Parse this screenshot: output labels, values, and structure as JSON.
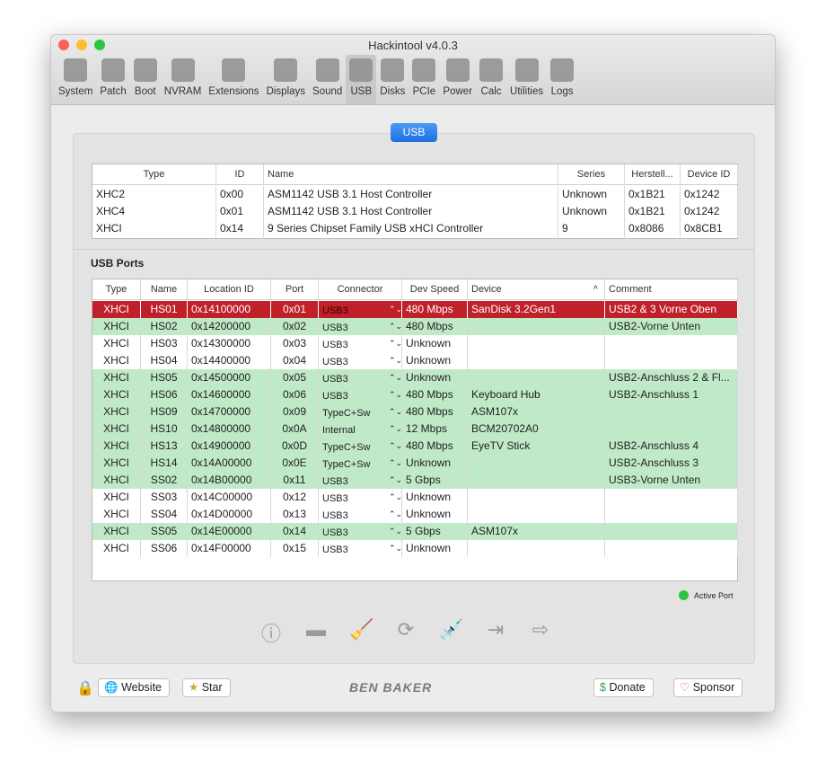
{
  "window": {
    "title": "Hackintool v4.0.3"
  },
  "toolbar": [
    "System",
    "Patch",
    "Boot",
    "NVRAM",
    "Extensions",
    "Displays",
    "Sound",
    "USB",
    "Disks",
    "PCIe",
    "Power",
    "Calc",
    "Utilities",
    "Logs"
  ],
  "active_tab": "USB",
  "section_tab": "USB",
  "controllers": {
    "headers": [
      "Type",
      "ID",
      "Name",
      "Series",
      "Herstell...",
      "Device ID"
    ],
    "rows": [
      [
        "XHC2",
        "0x00",
        "ASM1142 USB 3.1 Host Controller",
        "Unknown",
        "0x1B21",
        "0x1242"
      ],
      [
        "XHC4",
        "0x01",
        "ASM1142 USB 3.1 Host Controller",
        "Unknown",
        "0x1B21",
        "0x1242"
      ],
      [
        "XHCI",
        "0x14",
        "9 Series Chipset Family USB xHCI Controller",
        "9",
        "0x8086",
        "0x8CB1"
      ]
    ]
  },
  "ports_title": "USB Ports",
  "ports": {
    "headers": [
      "Type",
      "Name",
      "Location ID",
      "Port",
      "Connector",
      "Dev Speed",
      "Device",
      "Comment"
    ],
    "rows": [
      {
        "c": [
          "XHCI",
          "HS01",
          "0x14100000",
          "0x01",
          "USB3",
          "480 Mbps",
          "SanDisk 3.2Gen1",
          "USB2 & 3 Vorne Oben"
        ],
        "state": "selected"
      },
      {
        "c": [
          "XHCI",
          "HS02",
          "0x14200000",
          "0x02",
          "USB3",
          "480 Mbps",
          "",
          "USB2-Vorne Unten"
        ],
        "state": "active"
      },
      {
        "c": [
          "XHCI",
          "HS03",
          "0x14300000",
          "0x03",
          "USB3",
          "Unknown",
          "",
          ""
        ],
        "state": ""
      },
      {
        "c": [
          "XHCI",
          "HS04",
          "0x14400000",
          "0x04",
          "USB3",
          "Unknown",
          "",
          ""
        ],
        "state": ""
      },
      {
        "c": [
          "XHCI",
          "HS05",
          "0x14500000",
          "0x05",
          "USB3",
          "Unknown",
          "",
          "USB2-Anschluss 2 & Fl..."
        ],
        "state": "active"
      },
      {
        "c": [
          "XHCI",
          "HS06",
          "0x14600000",
          "0x06",
          "USB3",
          "480 Mbps",
          "Keyboard Hub",
          "USB2-Anschluss 1"
        ],
        "state": "active"
      },
      {
        "c": [
          "XHCI",
          "HS09",
          "0x14700000",
          "0x09",
          "TypeC+Sw",
          "480 Mbps",
          "ASM107x",
          ""
        ],
        "state": "active"
      },
      {
        "c": [
          "XHCI",
          "HS10",
          "0x14800000",
          "0x0A",
          "Internal",
          "12 Mbps",
          "BCM20702A0",
          ""
        ],
        "state": "active"
      },
      {
        "c": [
          "XHCI",
          "HS13",
          "0x14900000",
          "0x0D",
          "TypeC+Sw",
          "480 Mbps",
          "EyeTV Stick",
          "USB2-Anschluss 4"
        ],
        "state": "active"
      },
      {
        "c": [
          "XHCI",
          "HS14",
          "0x14A00000",
          "0x0E",
          "TypeC+Sw",
          "Unknown",
          "",
          "USB2-Anschluss 3"
        ],
        "state": "active"
      },
      {
        "c": [
          "XHCI",
          "SS02",
          "0x14B00000",
          "0x11",
          "USB3",
          "5 Gbps",
          "",
          "USB3-Vorne Unten"
        ],
        "state": "active"
      },
      {
        "c": [
          "XHCI",
          "SS03",
          "0x14C00000",
          "0x12",
          "USB3",
          "Unknown",
          "",
          ""
        ],
        "state": ""
      },
      {
        "c": [
          "XHCI",
          "SS04",
          "0x14D00000",
          "0x13",
          "USB3",
          "Unknown",
          "",
          ""
        ],
        "state": ""
      },
      {
        "c": [
          "XHCI",
          "SS05",
          "0x14E00000",
          "0x14",
          "USB3",
          "5 Gbps",
          "ASM107x",
          ""
        ],
        "state": "active"
      },
      {
        "c": [
          "XHCI",
          "SS06",
          "0x14F00000",
          "0x15",
          "USB3",
          "Unknown",
          "",
          ""
        ],
        "state": ""
      }
    ]
  },
  "legend": "Active Port",
  "colors": {
    "selected": "#bf2029",
    "active": "#bfe9c7",
    "accent": "#1f6fe0",
    "active_dot": "#2dc440"
  },
  "footer": {
    "website": "Website",
    "star": "Star",
    "logo": "BEN BAKER",
    "donate": "Donate",
    "sponsor": "Sponsor"
  }
}
